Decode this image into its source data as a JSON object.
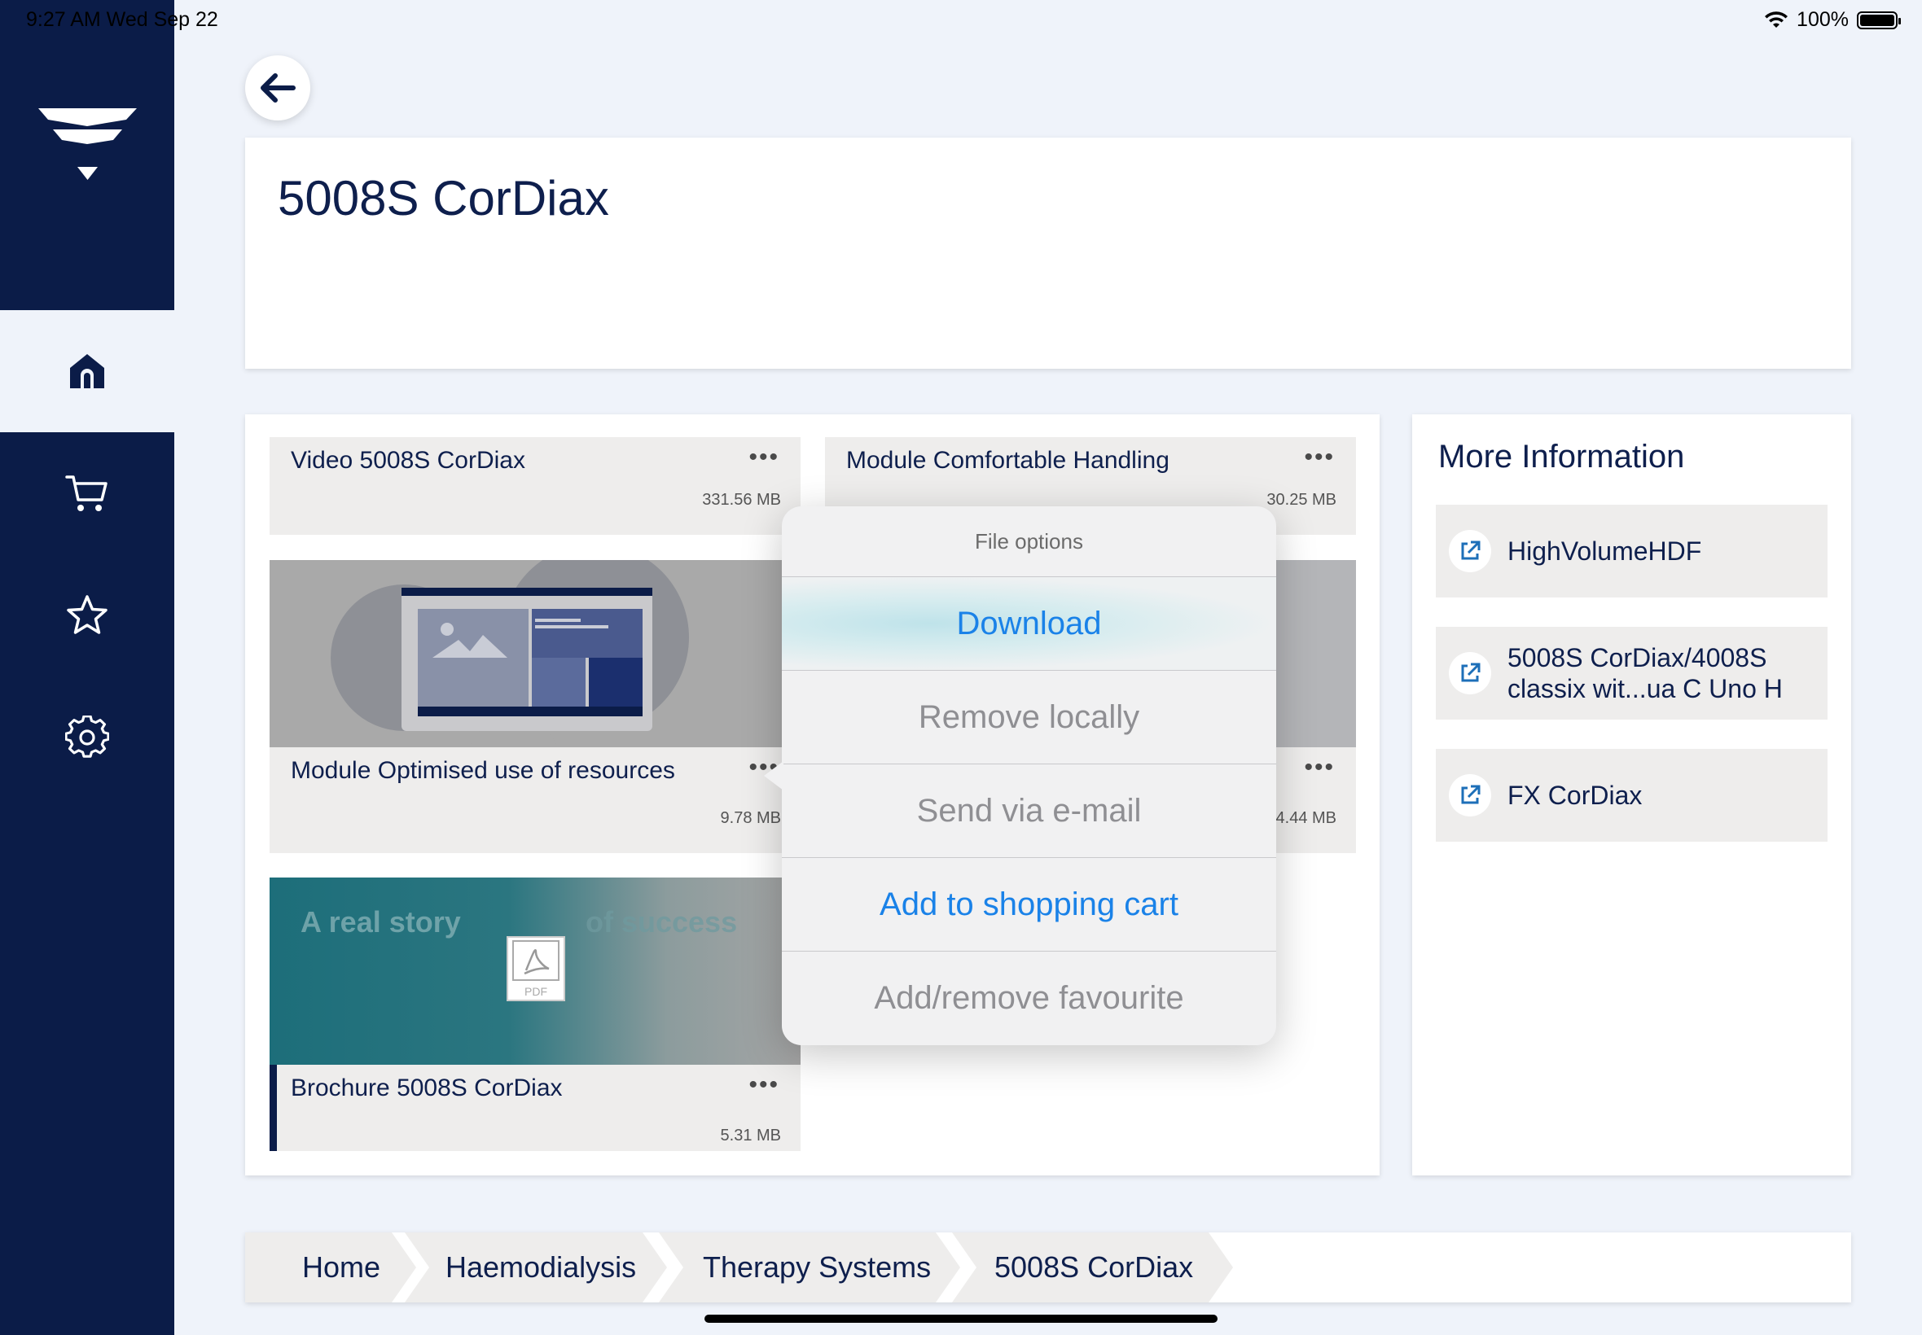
{
  "status_bar": {
    "time": "9:27 AM   Wed Sep 22",
    "battery": "100%"
  },
  "sidebar": {
    "items": [
      {
        "name": "home",
        "icon": "home-icon",
        "active": true
      },
      {
        "name": "cart",
        "icon": "cart-icon",
        "active": false
      },
      {
        "name": "favourites",
        "icon": "star-icon",
        "active": false
      },
      {
        "name": "settings",
        "icon": "gear-icon",
        "active": false
      }
    ]
  },
  "page": {
    "title": "5008S CorDiax"
  },
  "files": [
    {
      "name": "Video 5008S CorDiax",
      "size": "331.56 MB",
      "dots": "•••"
    },
    {
      "name": "Module Comfortable Handling",
      "size": "30.25 MB",
      "dots": "•••"
    },
    {
      "name": "Module Optimised use of resources",
      "size": "9.78 MB",
      "dots": "•••"
    },
    {
      "name": "",
      "size": "4.44 MB",
      "dots": "•••"
    },
    {
      "name": "Brochure 5008S CorDiax",
      "size": "5.31 MB",
      "dots": "•••",
      "thumb_text_left": "A real story",
      "thumb_text_right": "of success",
      "thumb_badge": "PDF"
    }
  ],
  "more_info": {
    "heading": "More Information",
    "links": [
      {
        "label": "HighVolumeHDF"
      },
      {
        "label": "5008S CorDiax/4008S classix wit...ua C Uno H"
      },
      {
        "label": "FX CorDiax"
      }
    ]
  },
  "file_options": {
    "title": "File options",
    "options": [
      {
        "label": "Download",
        "enabled": true
      },
      {
        "label": "Remove locally",
        "enabled": false
      },
      {
        "label": "Send via e-mail",
        "enabled": false
      },
      {
        "label": "Add to shopping cart",
        "enabled": true
      },
      {
        "label": "Add/remove favourite",
        "enabled": false
      }
    ]
  },
  "breadcrumb": [
    "Home",
    "Haemodialysis",
    "Therapy Systems",
    "5008S CorDiax"
  ],
  "colors": {
    "navy": "#0b1c48",
    "accent_blue": "#1a82e8",
    "tile_grey": "#eeedec",
    "background": "#eff3fa"
  }
}
